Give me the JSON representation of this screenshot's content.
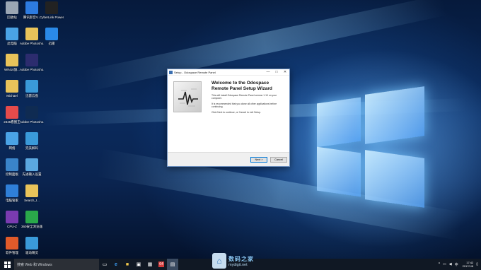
{
  "desktop_icons": [
    {
      "label": "回收站",
      "icon": "recycle-bin-icon",
      "color": "#9aa6b4"
    },
    {
      "label": "腾讯影音V...",
      "icon": "media-player-icon",
      "color": "#2d7be0"
    },
    {
      "label": "CyberLink PowerDV...",
      "icon": "powerdvd-icon",
      "color": "#222222"
    },
    {
      "label": "此电脑",
      "icon": "computer-icon",
      "color": "#4aa3e6"
    },
    {
      "label": "Adobe Photosho...",
      "icon": "folder-icon",
      "color": "#e8c35a"
    },
    {
      "label": "迅雷",
      "icon": "thunder-icon",
      "color": "#2a89e8"
    },
    {
      "label": "WIN10旗...",
      "icon": "folder-icon",
      "color": "#e8c35a"
    },
    {
      "label": "Adobe Photosho...",
      "icon": "photoshop-icon",
      "color": "#2c2c6e"
    },
    {
      "label": "Michael",
      "icon": "folder-icon",
      "color": "#e8c35a"
    },
    {
      "label": "迅雷云盘",
      "icon": "cloud-icon",
      "color": "#3a9ad9"
    },
    {
      "label": "2345看图王",
      "icon": "image-viewer-icon",
      "color": "#e54b4b"
    },
    {
      "label": "Adobe Photosho...",
      "icon": "photoshop-icon",
      "color": "#0f2b52"
    },
    {
      "label": "网络",
      "icon": "network-icon",
      "color": "#4aa3e6"
    },
    {
      "label": "完美解码",
      "icon": "decoder-icon",
      "color": "#3a9ad9"
    },
    {
      "label": "控制面板",
      "icon": "control-panel-icon",
      "color": "#3a84c9"
    },
    {
      "label": "先进输入设置",
      "icon": "settings-icon",
      "color": "#5ba8e0"
    },
    {
      "label": "电脑管家",
      "icon": "shield-icon",
      "color": "#2f7fd8"
    },
    {
      "label": "Search_I...",
      "icon": "file-icon",
      "color": "#e8c35a"
    },
    {
      "label": "CPU-Z",
      "icon": "cpuz-icon",
      "color": "#7a3bb0"
    },
    {
      "label": "360安全浏览器",
      "icon": "browser-icon",
      "color": "#2aa84a"
    },
    {
      "label": "软件管理",
      "icon": "software-manager-icon",
      "color": "#e05a2a"
    },
    {
      "label": "驱动精灵",
      "icon": "driver-icon",
      "color": "#3a9ad9"
    }
  ],
  "dialog": {
    "title": "Setup - Odospace Remote Panel",
    "heading": "Welcome to the Odospace Remote Panel Setup Wizard",
    "para1": "This will install Odospace Remote Panel version 1.10 on your computer.",
    "para2": "It is recommended that you close all other applications before continuing.",
    "para3": "Click Next to continue, or Cancel to exit Setup.",
    "next_label": "Next >",
    "cancel_label": "Cancel",
    "minimize": "—",
    "maximize": "□",
    "close": "✕"
  },
  "taskbar": {
    "search_placeholder": "搜索 Web 和 Windows",
    "apps": [
      "task-view-icon",
      "edge-icon",
      "explorer-icon",
      "store-icon",
      "app-icon",
      "app-64-icon",
      "setup-icon"
    ],
    "app64_label": "64",
    "time": "17:42",
    "date": "2017/1/8",
    "lang": "中"
  },
  "watermark": {
    "cn": "数码之家",
    "url": "mydigit.net"
  }
}
